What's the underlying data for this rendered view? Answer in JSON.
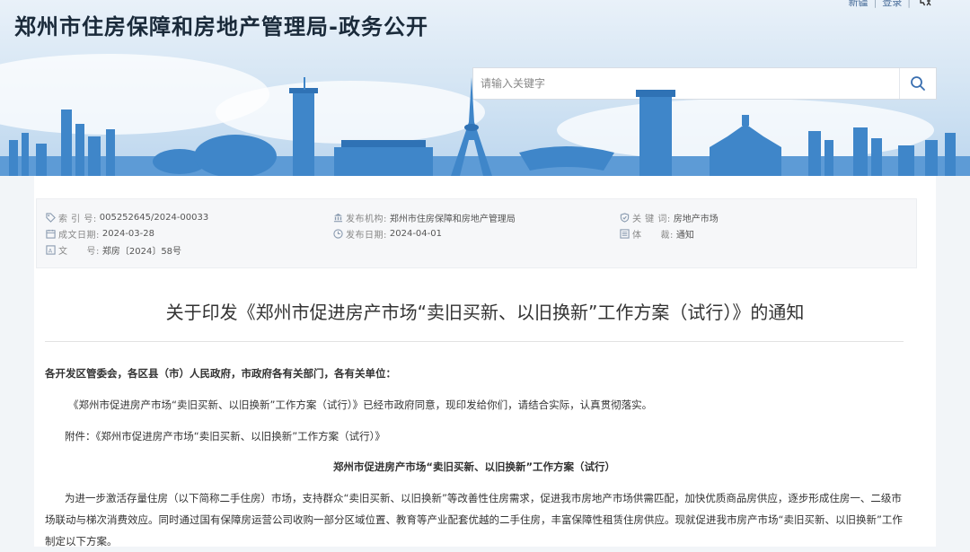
{
  "header": {
    "site_title": "郑州市住房保障和房地产管理局-政务公开",
    "top_links": [
      "新疆",
      "登录"
    ],
    "search_placeholder": "请输入关键字"
  },
  "meta": {
    "index_label": "索 引 号:",
    "index_value": "005252645/2024-00033",
    "written_label": "成文日期:",
    "written_value": "2024-03-28",
    "docno_label": "文　　号:",
    "docno_value": "郑房〔2024〕58号",
    "org_label": "发布机构:",
    "org_value": "郑州市住房保障和房地产管理局",
    "pubdate_label": "发布日期:",
    "pubdate_value": "2024-04-01",
    "keyword_label": "关 键 词:",
    "keyword_value": "房地产市场",
    "genre_label": "体　　裁:",
    "genre_value": "通知"
  },
  "article": {
    "title": "关于印发《郑州市促进房产市场“卖旧买新、以旧换新”工作方案（试行）》的通知",
    "salutation": "各开发区管委会，各区县（市）人民政府，市政府各有关部门，各有关单位：",
    "para1": "《郑州市促进房产市场“卖旧买新、以旧换新”工作方案（试行）》已经市政府同意，现印发给你们，请结合实际，认真贯彻落实。",
    "attachment": "附件：《郑州市促进房产市场“卖旧买新、以旧换新”工作方案（试行）》",
    "subtitle": "郑州市促进房产市场“卖旧买新、以旧换新”工作方案（试行）",
    "para2": "为进一步激活存量住房（以下简称二手住房）市场，支持群众“卖旧买新、以旧换新”等改善性住房需求，促进我市房地产市场供需匹配，加快优质商品房供应，逐步形成住房一、二级市场联动与梯次消费效应。同时通过国有保障房运营公司收购一部分区域位置、教育等产业配套优越的二手住房，丰富保障性租赁住房供应。现就促进我市房产市场“卖旧买新、以旧换新”工作制定以下方案。"
  }
}
